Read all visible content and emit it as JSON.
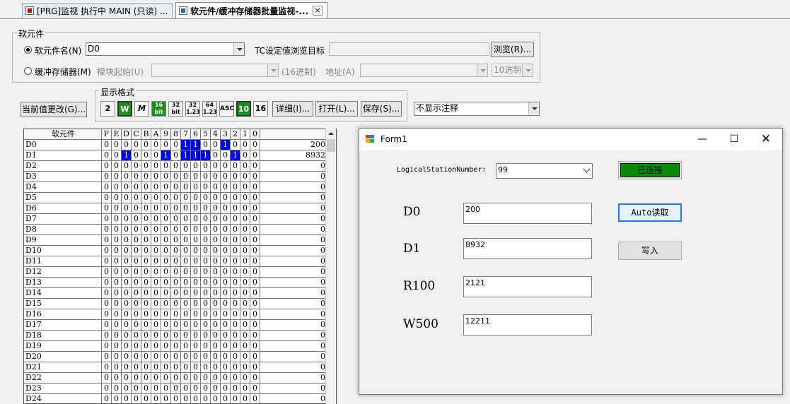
{
  "tabs": [
    {
      "label": "[PRG]监视 执行中 MAIN (只读) ...",
      "active": false,
      "icon": "program-icon"
    },
    {
      "label": "软元件/缓冲存储器批量监视-...",
      "active": true,
      "icon": "monitor-grid-icon"
    }
  ],
  "device_group": {
    "legend": "软元件",
    "radio_device_label": "软元件名(N)",
    "device_name_value": "D0",
    "tc_label": "TC设定值浏览目标",
    "browse_button": "浏览(R)...",
    "radio_buffer_label": "缓冲存储器(M)",
    "module_start_label": "模块起始(U)",
    "hex_label": "(16进制)",
    "address_label": "地址(A)",
    "decimal_value": "10进制"
  },
  "current_value_button": "当前值更改(G)...",
  "format_group": {
    "legend": "显示格式",
    "buttons": [
      "2",
      "W",
      "M",
      "16 bit",
      "32 bit",
      "32 1.23",
      "64 1.23",
      "ASC",
      "10",
      "16"
    ],
    "detail_button": "详细(I)...",
    "open_button": "打开(L)...",
    "save_button": "保存(S)..."
  },
  "comment_select_value": "不显示注释",
  "grid": {
    "header_device": "软元件",
    "bit_headers": [
      "F",
      "E",
      "D",
      "C",
      "B",
      "A",
      "9",
      "8",
      "7",
      "6",
      "5",
      "4",
      "3",
      "2",
      "1",
      "0"
    ],
    "rows": [
      {
        "name": "D0",
        "bits": "0000000011001000",
        "value": "200"
      },
      {
        "name": "D1",
        "bits": "0010001011100100",
        "value": "8932"
      },
      {
        "name": "D2",
        "bits": "0000000000000000",
        "value": "0"
      },
      {
        "name": "D3",
        "bits": "0000000000000000",
        "value": "0"
      },
      {
        "name": "D4",
        "bits": "0000000000000000",
        "value": "0"
      },
      {
        "name": "D5",
        "bits": "0000000000000000",
        "value": "0"
      },
      {
        "name": "D6",
        "bits": "0000000000000000",
        "value": "0"
      },
      {
        "name": "D7",
        "bits": "0000000000000000",
        "value": "0"
      },
      {
        "name": "D8",
        "bits": "0000000000000000",
        "value": "0"
      },
      {
        "name": "D9",
        "bits": "0000000000000000",
        "value": "0"
      },
      {
        "name": "D10",
        "bits": "0000000000000000",
        "value": "0"
      },
      {
        "name": "D11",
        "bits": "0000000000000000",
        "value": "0"
      },
      {
        "name": "D12",
        "bits": "0000000000000000",
        "value": "0"
      },
      {
        "name": "D13",
        "bits": "0000000000000000",
        "value": "0"
      },
      {
        "name": "D14",
        "bits": "0000000000000000",
        "value": "0"
      },
      {
        "name": "D15",
        "bits": "0000000000000000",
        "value": "0"
      },
      {
        "name": "D16",
        "bits": "0000000000000000",
        "value": "0"
      },
      {
        "name": "D17",
        "bits": "0000000000000000",
        "value": "0"
      },
      {
        "name": "D18",
        "bits": "0000000000000000",
        "value": "0"
      },
      {
        "name": "D19",
        "bits": "0000000000000000",
        "value": "0"
      },
      {
        "name": "D20",
        "bits": "0000000000000000",
        "value": "0"
      },
      {
        "name": "D21",
        "bits": "0000000000000000",
        "value": "0"
      },
      {
        "name": "D22",
        "bits": "0000000000000000",
        "value": "0"
      },
      {
        "name": "D23",
        "bits": "0000000000000000",
        "value": "0"
      },
      {
        "name": "D24",
        "bits": "0000000000000000",
        "value": "0"
      }
    ]
  },
  "form1": {
    "title": "Form1",
    "station_label": "LogicalStationNumber:",
    "station_value": "99",
    "connected_label": "已连接",
    "connected_color": "#0a8a0a",
    "auto_read_label": "Auto读取",
    "write_label": "写入",
    "fields": [
      {
        "label": "D0",
        "value": "200"
      },
      {
        "label": "D1",
        "value": "8932"
      },
      {
        "label": "R100",
        "value": "2121"
      },
      {
        "label": "W500",
        "value": "12211"
      }
    ]
  }
}
